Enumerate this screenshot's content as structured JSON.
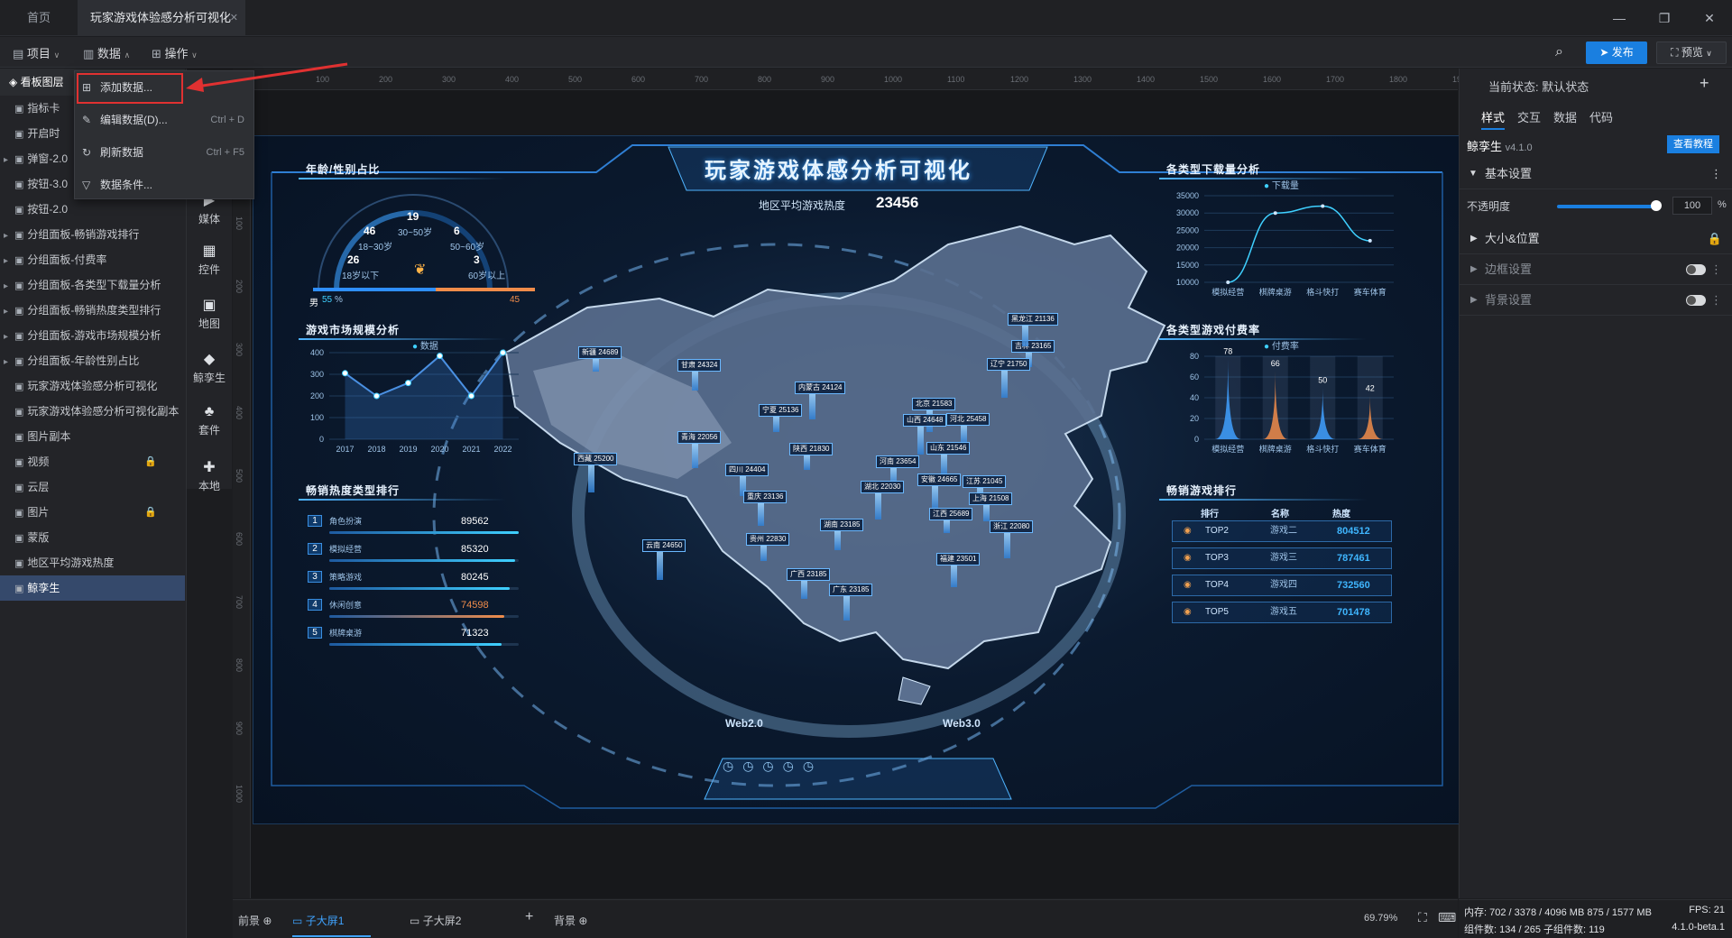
{
  "window": {
    "tabs": [
      "首页",
      "玩家游戏体验感分析可视化"
    ],
    "controls": [
      "—",
      "❐",
      "✕"
    ]
  },
  "toolbar": {
    "menus": [
      "项目",
      "数据",
      "操作"
    ],
    "publish": "发布",
    "preview": "预览"
  },
  "dropdown": {
    "items": [
      {
        "label": "添加数据...",
        "shortcut": ""
      },
      {
        "label": "编辑数据(D)...",
        "shortcut": "Ctrl + D"
      },
      {
        "label": "刷新数据",
        "shortcut": "Ctrl + F5"
      },
      {
        "label": "数据条件...",
        "shortcut": ""
      }
    ]
  },
  "layers": {
    "header": "看板图层",
    "items": [
      {
        "label": "指标卡",
        "locked": false
      },
      {
        "label": "开启时",
        "locked": false
      },
      {
        "label": "弹窗-2.0",
        "locked": false
      },
      {
        "label": "按钮-3.0",
        "locked": false
      },
      {
        "label": "按钮-2.0",
        "locked": false
      },
      {
        "label": "分组面板-畅销游戏排行",
        "locked": false
      },
      {
        "label": "分组面板-付费率",
        "locked": false
      },
      {
        "label": "分组面板-各类型下载量分析",
        "locked": false
      },
      {
        "label": "分组面板-畅销热度类型排行",
        "locked": false
      },
      {
        "label": "分组面板-游戏市场规模分析",
        "locked": false
      },
      {
        "label": "分组面板-年龄性别占比",
        "locked": false
      },
      {
        "label": "玩家游戏体验感分析可视化",
        "locked": false
      },
      {
        "label": "玩家游戏体验感分析可视化副本",
        "locked": false
      },
      {
        "label": "图片副本",
        "locked": false
      },
      {
        "label": "视频",
        "locked": true
      },
      {
        "label": "云层",
        "locked": false
      },
      {
        "label": "图片",
        "locked": true
      },
      {
        "label": "蒙版",
        "locked": false
      },
      {
        "label": "地区平均游戏热度",
        "locked": false
      },
      {
        "label": "鲸孪生",
        "locked": false,
        "selected": true
      }
    ]
  },
  "components": [
    "媒体",
    "控件",
    "地图",
    "鲸孪生",
    "套件",
    "本地"
  ],
  "ruler": {
    "top": [
      "100",
      "200",
      "300",
      "400",
      "500",
      "600",
      "700",
      "800",
      "900",
      "1000",
      "1100",
      "1200",
      "1300",
      "1400",
      "1500",
      "1600",
      "1700",
      "1800",
      "1900"
    ],
    "left": [
      "100",
      "200",
      "300",
      "400",
      "500",
      "600",
      "700",
      "800",
      "900",
      "1000"
    ]
  },
  "dashboard": {
    "title": "玩家游戏体感分析可视化",
    "heat_label": "地区平均游戏热度",
    "heat_value": "23456",
    "age_panel": {
      "title": "年龄/性别占比",
      "segments": [
        {
          "pct": "19",
          "range": "30~50岁"
        },
        {
          "pct": "46",
          "range": "18~30岁"
        },
        {
          "pct": "6",
          "range": "50~60岁"
        },
        {
          "pct": "26",
          "range": "18岁以下"
        },
        {
          "pct": "3",
          "range": "60岁以上"
        }
      ],
      "male_label": "男",
      "male_pct": "55",
      "female_pct": "45",
      "pct_sign": "%"
    },
    "market_panel": {
      "title": "游戏市场规模分析",
      "legend": "数据"
    },
    "hot_panel": {
      "title": "畅销热度类型排行",
      "rows": [
        {
          "rank": "1",
          "name": "角色扮演",
          "value": "89562"
        },
        {
          "rank": "2",
          "name": "模拟经营",
          "value": "85320"
        },
        {
          "rank": "3",
          "name": "策略游戏",
          "value": "80245"
        },
        {
          "rank": "4",
          "name": "休闲创意",
          "value": "74598"
        },
        {
          "rank": "5",
          "name": "棋牌桌游",
          "value": "71323"
        }
      ]
    },
    "download_panel": {
      "title": "各类型下载量分析",
      "legend": "下载量"
    },
    "pay_panel": {
      "title": "各类型游戏付费率",
      "legend": "付费率"
    },
    "top_panel": {
      "title": "畅销游戏排行",
      "headers": [
        "排行",
        "名称",
        "热度"
      ],
      "rows": [
        {
          "rank": "TOP2",
          "name": "游戏二",
          "value": "804512"
        },
        {
          "rank": "TOP3",
          "name": "游戏三",
          "value": "787461"
        },
        {
          "rank": "TOP4",
          "name": "游戏四",
          "value": "732560"
        },
        {
          "rank": "TOP5",
          "name": "游戏五",
          "value": "701478"
        }
      ]
    },
    "web2": "Web2.0",
    "web3": "Web3.0",
    "cities": [
      {
        "label": "新疆 24689"
      },
      {
        "label": "甘肃 24324"
      },
      {
        "label": "内蒙古 24124"
      },
      {
        "label": "宁夏 25136"
      },
      {
        "label": "北京 21583"
      },
      {
        "label": "山西 24648"
      },
      {
        "label": "河北 25458"
      },
      {
        "label": "青海 22056"
      },
      {
        "label": "陕西 21830"
      },
      {
        "label": "山东 21546"
      },
      {
        "label": "西藏 25200"
      },
      {
        "label": "河南 23654"
      },
      {
        "label": "安徽 24665"
      },
      {
        "label": "江苏 21045"
      },
      {
        "label": "四川 24404"
      },
      {
        "label": "湖北 22030"
      },
      {
        "label": "上海 21508"
      },
      {
        "label": "重庆 23136"
      },
      {
        "label": "江西 25689"
      },
      {
        "label": "湖南 23185"
      },
      {
        "label": "浙江 22080"
      },
      {
        "label": "贵州 22830"
      },
      {
        "label": "福建 23501"
      },
      {
        "label": "云南 24650"
      },
      {
        "label": "广西 23185"
      },
      {
        "label": "广东 23185"
      },
      {
        "label": "吉林 23165"
      },
      {
        "label": "黑龙江 21136"
      },
      {
        "label": "辽宁 21750"
      }
    ]
  },
  "chart_data": [
    {
      "type": "line",
      "title": "游戏市场规模分析",
      "categories": [
        "2017",
        "2018",
        "2019",
        "2020",
        "2021",
        "2022"
      ],
      "series": [
        {
          "name": "数据",
          "values": [
            305,
            200,
            260,
            385,
            200,
            400
          ]
        }
      ],
      "ylim": [
        0,
        400
      ],
      "yticks": [
        "0",
        "100",
        "200",
        "300",
        "400"
      ]
    },
    {
      "type": "area",
      "title": "各类型下载量分析",
      "categories": [
        "模拟经营",
        "棋牌桌游",
        "格斗快打",
        "赛车体育"
      ],
      "series": [
        {
          "name": "下载量",
          "values": [
            10000,
            30000,
            32000,
            22000
          ]
        }
      ],
      "ylim": [
        10000,
        35000
      ],
      "yticks": [
        "10000",
        "15000",
        "20000",
        "25000",
        "30000",
        "35000"
      ]
    },
    {
      "type": "bar",
      "title": "各类型游戏付费率",
      "categories": [
        "模拟经营",
        "棋牌桌游",
        "格斗快打",
        "赛车体育"
      ],
      "series": [
        {
          "name": "付费率",
          "values": [
            78,
            66,
            50,
            42
          ]
        }
      ],
      "ylim": [
        0,
        80
      ],
      "yticks": [
        "0",
        "20",
        "40",
        "60",
        "80"
      ]
    }
  ],
  "right_panel": {
    "state_label": "当前状态:",
    "state_value": "默认状态",
    "tabs": [
      "样式",
      "交互",
      "数据",
      "代码"
    ],
    "component_name": "鲸孪生",
    "version": "v4.1.0",
    "tutorial": "查看教程",
    "basic": "基本设置",
    "opacity_label": "不透明度",
    "opacity_value": "100",
    "opacity_unit": "%",
    "size_pos": "大小&位置",
    "border": "边框设置",
    "background": "背景设置"
  },
  "bottom": {
    "foreground": "前景",
    "sub1": "子大屏1",
    "sub2": "子大屏2",
    "background": "背景",
    "zoom": "69.79%"
  },
  "status": {
    "memory": "内存: 702 / 3378 / 4096 MB  875 / 1577 MB",
    "fps": "FPS: 21",
    "components": "组件数: 134 / 265   子组件数: 119",
    "version": "4.1.0-beta.1"
  },
  "colors": {
    "accent": "#1a7fe0",
    "highlight": "#e03131",
    "selected_layer": "#35496b",
    "line_series": "#4a90e2",
    "chart_cyan": "#3fd0ff"
  }
}
